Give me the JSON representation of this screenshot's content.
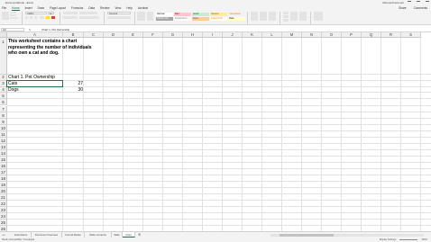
{
  "window": {
    "title": "Excel workbook - Excel",
    "user": "Microsoft account"
  },
  "menu": {
    "items": [
      "File",
      "Home",
      "Insert",
      "Draw",
      "Page Layout",
      "Formulas",
      "Data",
      "Review",
      "View",
      "Help",
      "Acrobat"
    ],
    "active": "Home",
    "right_items": [
      "Share",
      "Comments"
    ]
  },
  "ribbon": {
    "font_name": "Calibri",
    "font_size": "11",
    "number_format": "General",
    "styles": [
      {
        "label": "Normal",
        "bg": "#ffffff",
        "color": "#000000"
      },
      {
        "label": "Bad",
        "bg": "#ffc7ce",
        "color": "#9c0006"
      },
      {
        "label": "Good",
        "bg": "#c6efce",
        "color": "#006100"
      },
      {
        "label": "Neutral",
        "bg": "#ffeb9c",
        "color": "#9c5700"
      },
      {
        "label": "Calculation",
        "bg": "#f2f2f2",
        "color": "#fa7d00"
      },
      {
        "label": "Check Cell",
        "bg": "#a5a5a5",
        "color": "#ffffff"
      },
      {
        "label": "Explanatory ...",
        "bg": "#ffffff",
        "color": "#7f7f7f"
      },
      {
        "label": "Input",
        "bg": "#ffcc99",
        "color": "#3f3f76"
      },
      {
        "label": "Linked Cell",
        "bg": "#ffffff",
        "color": "#fa7d00"
      },
      {
        "label": "Note",
        "bg": "#ffffcc",
        "color": "#000000"
      }
    ]
  },
  "formula_bar": {
    "name_box": "A3",
    "fx": "fx",
    "content": "Chart 1. Pet Ownership"
  },
  "columns": [
    "A",
    "B",
    "C",
    "D",
    "E",
    "F",
    "G",
    "H",
    "I",
    "J",
    "K",
    "L",
    "M",
    "N",
    "O",
    "P",
    "Q",
    "R",
    "S"
  ],
  "rows": [
    "1",
    "2",
    "3",
    "4",
    "5",
    "6",
    "7",
    "8",
    "9",
    "10",
    "11",
    "12",
    "13",
    "14",
    "15",
    "16",
    "17",
    "18",
    "19",
    "20",
    "21",
    "22",
    "23",
    "24",
    "25",
    "26",
    "27",
    "28",
    "29"
  ],
  "cells": {
    "A1": "This worksheet contains a chart representing the number of individuals who own a cat and dog.",
    "A2": "Chart 1. Pet Ownership",
    "A3": "Cats",
    "B3": "27",
    "A4": "Dogs",
    "B4": "30"
  },
  "sheet_tabs": [
    "Instructions",
    "Document Overview",
    "Format Marks",
    "Table Contents",
    "Table",
    "Chart"
  ],
  "active_tab": "Chart",
  "status": {
    "left": "Ready   Accessibility: Investigate",
    "display_settings": "Display Settings",
    "zoom": "100%"
  },
  "colors": {
    "accent": "#217346",
    "header_bg": "#efefef",
    "gridline": "#e2e2e2"
  }
}
